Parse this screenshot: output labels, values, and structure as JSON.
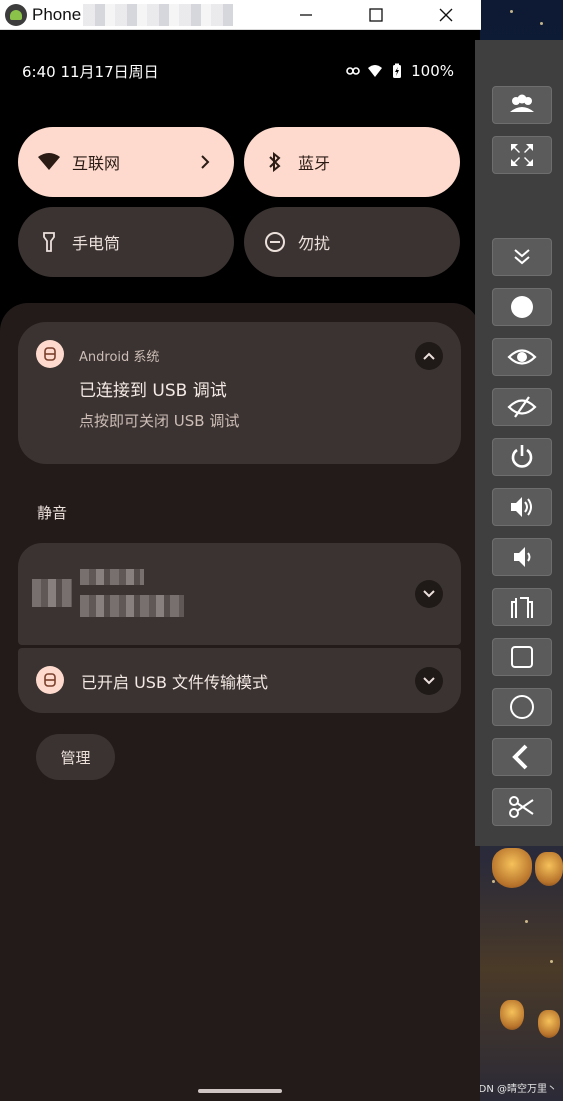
{
  "window": {
    "title": "Phone"
  },
  "status_bar": {
    "time_date": "6:40 11月17日周日",
    "battery": "100%"
  },
  "quick_settings": {
    "tiles": [
      {
        "label": "互联网",
        "state": "on",
        "icon": "wifi-icon"
      },
      {
        "label": "蓝牙",
        "state": "on",
        "icon": "bluetooth-icon"
      },
      {
        "label": "手电筒",
        "state": "off",
        "icon": "flashlight-icon"
      },
      {
        "label": "勿扰",
        "state": "off",
        "icon": "do-not-disturb-icon"
      }
    ]
  },
  "notifications": {
    "usb_debug": {
      "app_name": "Android 系统",
      "title": "已连接到 USB 调试",
      "text": "点按即可关闭 USB 调试"
    },
    "silent_section_label": "静音",
    "usb_file_transfer": {
      "title": "已开启 USB 文件传输模式"
    },
    "manage_label": "管理"
  },
  "emulator_toolbar": {
    "buttons": [
      "multi-user-icon",
      "fullscreen-icon",
      "collapse-icon",
      "record-icon",
      "eye-icon",
      "eye-off-icon",
      "power-icon",
      "volume-up-icon",
      "volume-down-icon",
      "rotate-icon",
      "recents-icon",
      "home-icon",
      "back-icon",
      "screenshot-cut-icon"
    ]
  },
  "watermark": "CSDN @晴空万里丶",
  "colors": {
    "tile_on": "#fddacd",
    "tile_off": "#3a3331",
    "shade_bg": "#221b1a",
    "toolbar_bg": "#3f3f3f"
  }
}
